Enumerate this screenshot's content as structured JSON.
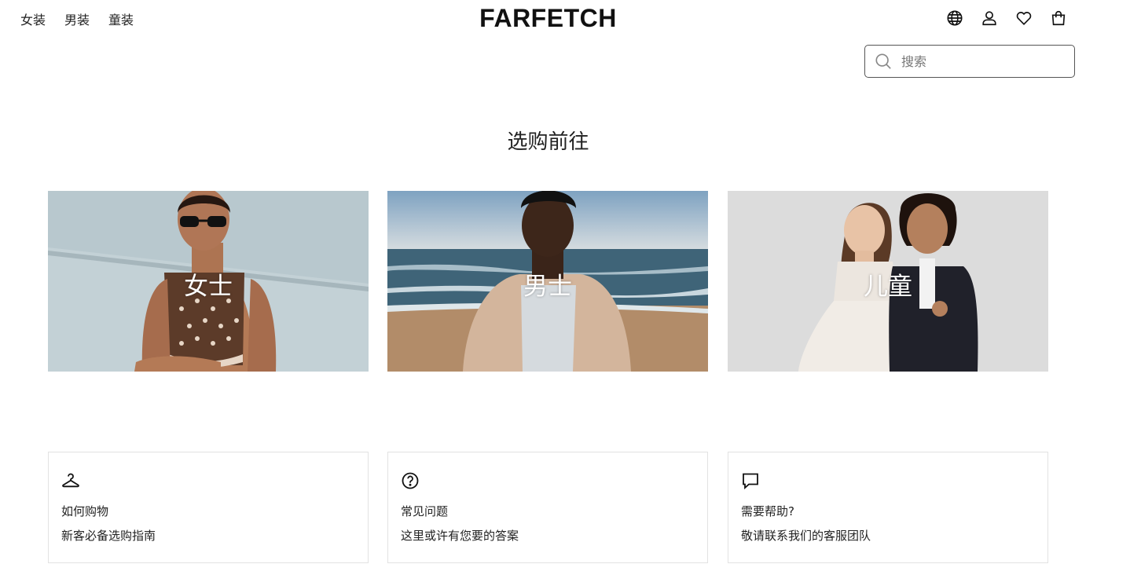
{
  "header": {
    "nav": [
      "女装",
      "男装",
      "童装"
    ],
    "logo": "FARFETCH",
    "icons": [
      "globe-icon",
      "account-icon",
      "heart-icon",
      "bag-icon"
    ]
  },
  "search": {
    "placeholder": "搜索",
    "icon": "search-icon"
  },
  "main": {
    "heading": "选购前往",
    "categories": [
      {
        "label": "女士",
        "image": "woman-sunglasses-photo"
      },
      {
        "label": "男士",
        "image": "man-beach-photo"
      },
      {
        "label": "儿童",
        "image": "kids-formal-photo"
      }
    ]
  },
  "help": [
    {
      "icon": "hanger-icon",
      "title": "如何购物",
      "subtitle": "新客必备选购指南"
    },
    {
      "icon": "question-circle-icon",
      "title": "常见问题",
      "subtitle": "这里或许有您要的答案"
    },
    {
      "icon": "chat-bubble-icon",
      "title": "需要帮助?",
      "subtitle": "敬请联系我们的客服团队"
    }
  ],
  "colors": {
    "text": "#222222",
    "border": "#e2e2e2",
    "background": "#ffffff"
  }
}
